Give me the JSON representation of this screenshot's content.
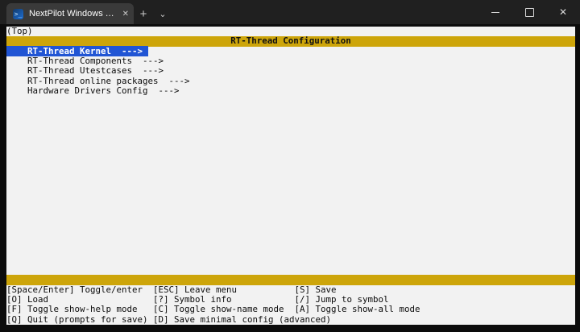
{
  "window": {
    "tab": {
      "title": "NextPilot Windows Toolchain",
      "close_icon": "✕"
    },
    "new_tab_icon": "+",
    "tab_dropdown_icon": "⌄",
    "controls": {
      "close_icon": "✕"
    },
    "tab_icon_glyph": ">_"
  },
  "terminal": {
    "breadcrumb": "(Top)",
    "title": "RT-Thread Configuration",
    "menu_items": [
      {
        "label": "    RT-Thread Kernel  --->",
        "selected": true
      },
      {
        "label": "    RT-Thread Components  --->",
        "selected": false
      },
      {
        "label": "    RT-Thread Utestcases  --->",
        "selected": false
      },
      {
        "label": "    RT-Thread online packages  --->",
        "selected": false
      },
      {
        "label": "    Hardware Drivers Config  --->",
        "selected": false
      }
    ],
    "help_lines": [
      "[Space/Enter] Toggle/enter  [ESC] Leave menu           [S] Save",
      "[O] Load                    [?] Symbol info            [/] Jump to symbol",
      "[F] Toggle show-help mode   [C] Toggle show-name mode  [A] Toggle show-all mode",
      "[Q] Quit (prompts for save) [D] Save minimal config (advanced)"
    ],
    "colors": {
      "header_bg": "#cda50a",
      "selection_bg": "#2155d4",
      "selection_text": "#ffffff",
      "screen_bg": "#f2f2f2",
      "padding_bg": "#0c0c0c",
      "titlebar_bg": "#202020",
      "text": "#0c0c0c"
    }
  }
}
